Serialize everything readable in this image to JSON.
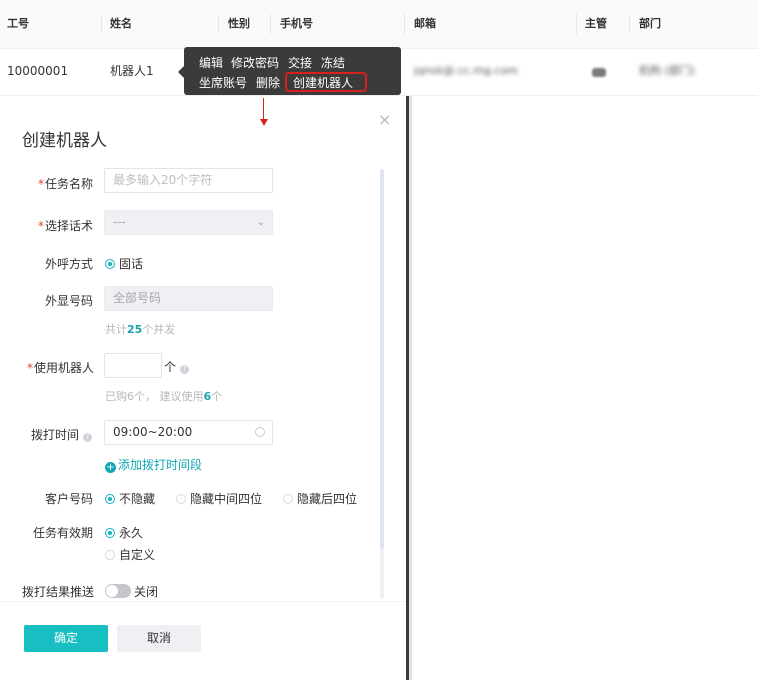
{
  "table": {
    "headers": [
      "工号",
      "姓名",
      "性别",
      "手机号",
      "邮箱",
      "主管",
      "部门"
    ],
    "row": {
      "id": "10000001",
      "name": "机器人1",
      "email_blurred": "jqnsk@.cc.mg.com",
      "dept_blurred": "机构 (部门)"
    }
  },
  "tooltip": {
    "edit": "编辑",
    "change_password": "修改密码",
    "handover": "交接",
    "freeze": "冻结",
    "seat_account": "坐席账号",
    "delete": "删除",
    "create_robot": "创建机器人"
  },
  "drawer": {
    "title": "创建机器人",
    "close_icon": "close-icon",
    "task_name": {
      "label": "任务名称",
      "placeholder": "最多输入20个字符"
    },
    "script": {
      "label": "选择话术",
      "value": "---"
    },
    "call_mode": {
      "label": "外呼方式",
      "option": "固话"
    },
    "display_number": {
      "label": "外显号码",
      "value": "全部号码",
      "hint_prefix": "共计",
      "hint_count": "25",
      "hint_suffix": "个并发"
    },
    "robot_use": {
      "label": "使用机器人",
      "unit": "个",
      "hint_prefix": "已购6个，  建议使用",
      "hint_count": "6",
      "hint_suffix": "个"
    },
    "dial_time": {
      "label": "拨打时间",
      "value": "09:00~20:00",
      "add_link": "添加拨打时间段"
    },
    "customer_number": {
      "label": "客户号码",
      "options": [
        "不隐藏",
        "隐藏中间四位",
        "隐藏后四位"
      ],
      "selected": 0
    },
    "validity": {
      "label": "任务有效期",
      "options": [
        "永久",
        "自定义"
      ],
      "selected": 0
    },
    "result_push": {
      "label": "拨打结果推送",
      "state": "关闭"
    },
    "confirm": "确定",
    "cancel": "取消"
  },
  "colors": {
    "primary": "#17bec2",
    "highlight": "#d9211c",
    "tooltip_bg": "#3b3b3b"
  }
}
